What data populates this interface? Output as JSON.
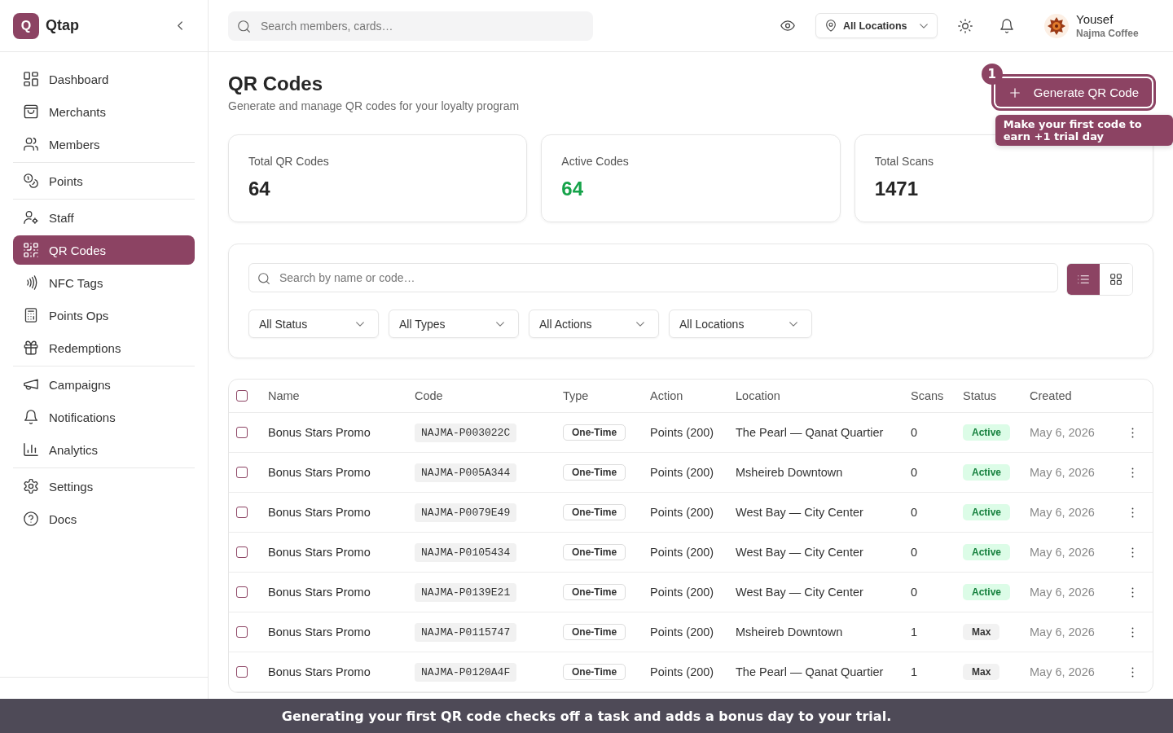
{
  "app": {
    "logo_letter": "Q",
    "name": "Qtap"
  },
  "sidebar": {
    "groups": [
      {
        "items": [
          {
            "label": "Dashboard",
            "selected": false
          },
          {
            "label": "Merchants",
            "selected": false
          },
          {
            "label": "Members",
            "selected": false
          }
        ]
      },
      {
        "items": [
          {
            "label": "Points",
            "selected": false
          }
        ]
      },
      {
        "items": [
          {
            "label": "Staff",
            "selected": false
          },
          {
            "label": "QR Codes",
            "selected": true
          },
          {
            "label": "NFC Tags",
            "selected": false
          },
          {
            "label": "Points Ops",
            "selected": false
          },
          {
            "label": "Redemptions",
            "selected": false
          }
        ]
      },
      {
        "items": [
          {
            "label": "Campaigns",
            "selected": false
          },
          {
            "label": "Notifications",
            "selected": false
          },
          {
            "label": "Analytics",
            "selected": false
          }
        ]
      },
      {
        "items": [
          {
            "label": "Settings",
            "selected": false
          },
          {
            "label": "Docs",
            "selected": false
          }
        ]
      }
    ]
  },
  "topbar": {
    "search": {
      "placeholder": "Search members, cards…"
    },
    "location": "All Locations",
    "user": {
      "name": "Yousef",
      "business": "Najma Coffee"
    }
  },
  "page": {
    "title": "QR Codes",
    "subtitle": "Generate and manage QR codes for your loyalty program",
    "primary_button": "Generate QR Code"
  },
  "stats": [
    {
      "label": "Total QR Codes",
      "value": "64",
      "color": "#262626"
    },
    {
      "label": "Active Codes",
      "value": "64",
      "color": "#16a34a"
    },
    {
      "label": "Total Scans",
      "value": "1471",
      "color": "#262626"
    }
  ],
  "filters": {
    "search": {
      "placeholder": "Search by name or code…"
    },
    "views": [
      {
        "kind": "list",
        "selected": true
      },
      {
        "kind": "grid",
        "selected": false
      }
    ],
    "selects": [
      "All Status",
      "All Types",
      "All Actions",
      "All Locations"
    ]
  },
  "table": {
    "select_all": {
      "checked": false
    },
    "columns": [
      "Name",
      "Code",
      "Type",
      "Action",
      "Location",
      "Scans",
      "Status",
      "Created"
    ],
    "rows": [
      {
        "name": "Bonus Stars Promo",
        "code": "NAJMA-P003022C",
        "type": "One-Time",
        "action": "Points (200)",
        "location": "The Pearl — Qanat Quartier",
        "scans": "0",
        "status": {
          "label": "Active",
          "kind": "active"
        },
        "created": "May 6, 2026",
        "checked": false
      },
      {
        "name": "Bonus Stars Promo",
        "code": "NAJMA-P005A344",
        "type": "One-Time",
        "action": "Points (200)",
        "location": "Msheireb Downtown",
        "scans": "0",
        "status": {
          "label": "Active",
          "kind": "active"
        },
        "created": "May 6, 2026",
        "checked": false
      },
      {
        "name": "Bonus Stars Promo",
        "code": "NAJMA-P0079E49",
        "type": "One-Time",
        "action": "Points (200)",
        "location": "West Bay — City Center",
        "scans": "0",
        "status": {
          "label": "Active",
          "kind": "active"
        },
        "created": "May 6, 2026",
        "checked": false
      },
      {
        "name": "Bonus Stars Promo",
        "code": "NAJMA-P0105434",
        "type": "One-Time",
        "action": "Points (200)",
        "location": "West Bay — City Center",
        "scans": "0",
        "status": {
          "label": "Active",
          "kind": "active"
        },
        "created": "May 6, 2026",
        "checked": false
      },
      {
        "name": "Bonus Stars Promo",
        "code": "NAJMA-P0139E21",
        "type": "One-Time",
        "action": "Points (200)",
        "location": "West Bay — City Center",
        "scans": "0",
        "status": {
          "label": "Active",
          "kind": "active"
        },
        "created": "May 6, 2026",
        "checked": false
      },
      {
        "name": "Bonus Stars Promo",
        "code": "NAJMA-P0115747",
        "type": "One-Time",
        "action": "Points (200)",
        "location": "Msheireb Downtown",
        "scans": "1",
        "status": {
          "label": "Max",
          "kind": "max"
        },
        "created": "May 6, 2026",
        "checked": false
      },
      {
        "name": "Bonus Stars Promo",
        "code": "NAJMA-P0120A4F",
        "type": "One-Time",
        "action": "Points (200)",
        "location": "The Pearl — Qanat Quartier",
        "scans": "1",
        "status": {
          "label": "Max",
          "kind": "max"
        },
        "created": "May 6, 2026",
        "checked": false
      }
    ]
  },
  "onboarding": {
    "step": "1",
    "tooltip": "Make your first code to earn +1 trial day",
    "banner": "Generating your first QR code checks off a task and adds a bonus day to your trial."
  }
}
